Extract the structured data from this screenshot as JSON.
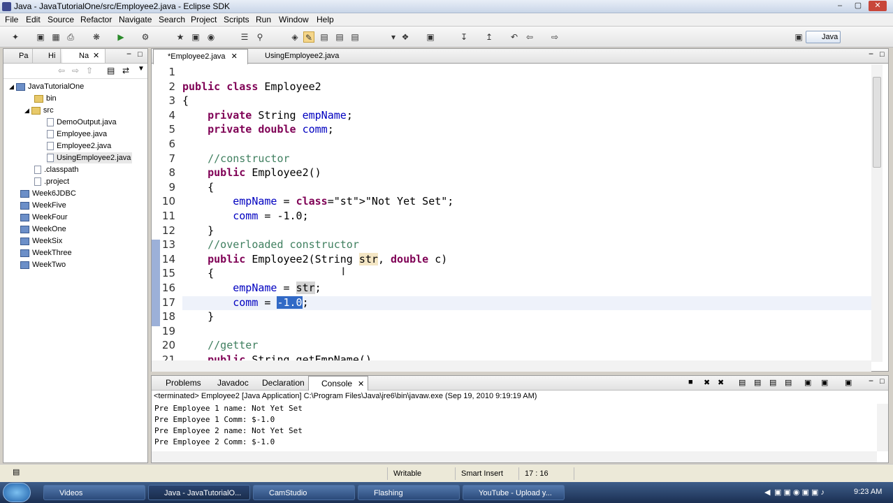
{
  "window": {
    "title": "Java - JavaTutorialOne/src/Employee2.java - Eclipse SDK"
  },
  "menu": [
    "File",
    "Edit",
    "Source",
    "Refactor",
    "Navigate",
    "Search",
    "Project",
    "Scripts",
    "Run",
    "Window",
    "Help"
  ],
  "perspective": "Java",
  "left_tabs": [
    "Pa",
    "Hi",
    "Na"
  ],
  "tree": [
    {
      "label": "JavaTutorialOne",
      "type": "project",
      "level": 0
    },
    {
      "label": "bin",
      "type": "folder",
      "level": 1
    },
    {
      "label": "src",
      "type": "folder",
      "level": 1
    },
    {
      "label": "DemoOutput.java",
      "type": "file",
      "level": 2
    },
    {
      "label": "Employee.java",
      "type": "file",
      "level": 2
    },
    {
      "label": "Employee2.java",
      "type": "file",
      "level": 2
    },
    {
      "label": "UsingEmployee2.java",
      "type": "file",
      "level": 2
    },
    {
      "label": ".classpath",
      "type": "file",
      "level": 1
    },
    {
      "label": ".project",
      "type": "file",
      "level": 1
    },
    {
      "label": "Week6JDBC",
      "type": "project",
      "level": 0
    },
    {
      "label": "WeekFive",
      "type": "project",
      "level": 0
    },
    {
      "label": "WeekFour",
      "type": "project",
      "level": 0
    },
    {
      "label": "WeekOne",
      "type": "project",
      "level": 0
    },
    {
      "label": "WeekSix",
      "type": "project",
      "level": 0
    },
    {
      "label": "WeekThree",
      "type": "project",
      "level": 0
    },
    {
      "label": "WeekTwo",
      "type": "project",
      "level": 0
    }
  ],
  "editor_tabs": [
    "*Employee2.java",
    "UsingEmployee2.java"
  ],
  "code_lines": [
    {
      "n": "1",
      "text": ""
    },
    {
      "n": "2",
      "text": "public class Employee2"
    },
    {
      "n": "3",
      "text": "{"
    },
    {
      "n": "4",
      "text": "    private String empName;"
    },
    {
      "n": "5",
      "text": "    private double comm;"
    },
    {
      "n": "6",
      "text": ""
    },
    {
      "n": "7",
      "text": "    //constructor"
    },
    {
      "n": "8",
      "text": "    public Employee2()"
    },
    {
      "n": "9",
      "text": "    {"
    },
    {
      "n": "10",
      "text": "        empName = \"Not Yet Set\";"
    },
    {
      "n": "11",
      "text": "        comm = -1.0;"
    },
    {
      "n": "12",
      "text": "    }"
    },
    {
      "n": "13",
      "text": "    //overloaded constructor"
    },
    {
      "n": "14",
      "text": "    public Employee2(String str, double c)"
    },
    {
      "n": "15",
      "text": "    {"
    },
    {
      "n": "16",
      "text": "        empName = str;"
    },
    {
      "n": "17",
      "text": "        comm = -1.0;"
    },
    {
      "n": "18",
      "text": "    }"
    },
    {
      "n": "19",
      "text": ""
    },
    {
      "n": "20",
      "text": "    //getter"
    },
    {
      "n": "21",
      "text": "    public String getEmpName()"
    }
  ],
  "console_tabs": [
    "Problems",
    "Javadoc",
    "Declaration",
    "Console"
  ],
  "console_header": "<terminated> Employee2 [Java Application] C:\\Program Files\\Java\\jre6\\bin\\javaw.exe (Sep 19, 2010 9:19:19 AM)",
  "console_lines": [
    "Pre Employee 1 name: Not Yet Set",
    "Pre Employee 1 Comm: $-1.0",
    "Pre Employee 2 name: Not Yet Set",
    "Pre Employee 2 Comm: $-1.0"
  ],
  "status": {
    "writable": "Writable",
    "insert": "Smart Insert",
    "position": "17 : 16"
  },
  "taskbar": [
    "Videos",
    "Java - JavaTutorialO...",
    "CamStudio",
    "Flashing",
    "YouTube - Upload y..."
  ],
  "clock": "9:23 AM"
}
